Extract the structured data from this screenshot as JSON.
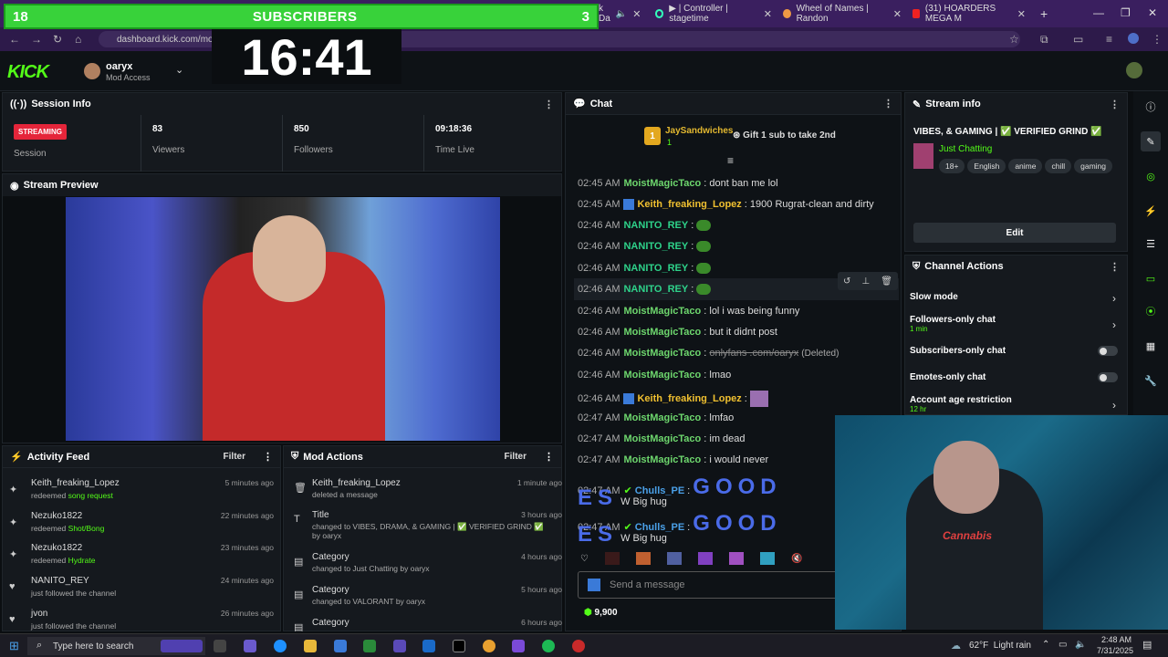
{
  "browser": {
    "tabs": [
      {
        "label": "k Da"
      },
      {
        "label": "▶ | Controller | stagetime"
      },
      {
        "label": "Wheel of Names | Randon"
      },
      {
        "label": "(31) HOARDERS MEGA M"
      }
    ],
    "new_tab": "+",
    "url": "dashboard.kick.com/mod"
  },
  "overlay": {
    "sub_left": "18",
    "sub_title": "SUBSCRIBERS",
    "sub_right": "3",
    "timer": "16:41"
  },
  "header": {
    "logo": "KICK",
    "username": "oaryx",
    "role": "Mod Access"
  },
  "session": {
    "title": "Session Info",
    "badge": "STREAMING",
    "session_label": "Session",
    "viewers_value": "83",
    "viewers_label": "Viewers",
    "followers_value": "850",
    "followers_label": "Followers",
    "time_value": "09:18:36",
    "time_label": "Time Live"
  },
  "preview": {
    "title": "Stream Preview"
  },
  "activity": {
    "title": "Activity Feed",
    "filter": "Filter",
    "items": [
      {
        "name": "Keith_freaking_Lopez",
        "action": "redeemed",
        "detail": "song request",
        "time": "5 minutes ago"
      },
      {
        "name": "Nezuko1822",
        "action": "redeemed",
        "detail": "Shot/Bong",
        "time": "22 minutes ago"
      },
      {
        "name": "Nezuko1822",
        "action": "redeemed",
        "detail": "Hydrate",
        "time": "23 minutes ago"
      },
      {
        "name": "NANITO_REY",
        "action": "just followed the channel",
        "detail": "",
        "time": "24 minutes ago"
      },
      {
        "name": "jvon",
        "action": "just followed the channel",
        "detail": "",
        "time": "26 minutes ago"
      }
    ]
  },
  "modactions": {
    "title": "Mod Actions",
    "filter": "Filter",
    "items": [
      {
        "name": "Keith_freaking_Lopez",
        "desc": "deleted a message",
        "time": "1 minute ago"
      },
      {
        "name": "Title",
        "desc": "changed to VIBES, DRAMA, & GAMING | ✅ VERIFIED GRIND ✅ by oaryx",
        "time": "3 hours ago"
      },
      {
        "name": "Category",
        "desc": "changed to Just Chatting by oaryx",
        "time": "4 hours ago"
      },
      {
        "name": "Category",
        "desc": "changed to VALORANT by oaryx",
        "time": "5 hours ago"
      },
      {
        "name": "Category",
        "desc": "",
        "time": "6 hours ago"
      }
    ]
  },
  "chat": {
    "title": "Chat",
    "gifter": "JaySandwiches",
    "gifter_count": "1",
    "gift_text": "Gift 1 sub to take 2nd",
    "messages": [
      {
        "ts": "02:45 AM",
        "user": "MoistMagicTaco",
        "color": "#6dd66d",
        "text": "dont ban me lol"
      },
      {
        "ts": "02:45 AM",
        "user": "Keith_freaking_Lopez",
        "color": "#f0c030",
        "text": "1900 Rugrat-clean and dirty"
      },
      {
        "ts": "02:46 AM",
        "user": "NANITO_REY",
        "color": "#2ed28a",
        "text": ""
      },
      {
        "ts": "02:46 AM",
        "user": "NANITO_REY",
        "color": "#2ed28a",
        "text": ""
      },
      {
        "ts": "02:46 AM",
        "user": "NANITO_REY",
        "color": "#2ed28a",
        "text": ""
      },
      {
        "ts": "02:46 AM",
        "user": "NANITO_REY",
        "color": "#2ed28a",
        "text": ""
      },
      {
        "ts": "02:46 AM",
        "user": "MoistMagicTaco",
        "color": "#6dd66d",
        "text": "lol i was being funny"
      },
      {
        "ts": "02:46 AM",
        "user": "MoistMagicTaco",
        "color": "#6dd66d",
        "text": "but it didnt post"
      },
      {
        "ts": "02:46 AM",
        "user": "MoistMagicTaco",
        "color": "#6dd66d",
        "text": "onlyfans .com/oaryx",
        "deleted": "(Deleted)"
      },
      {
        "ts": "02:46 AM",
        "user": "MoistMagicTaco",
        "color": "#6dd66d",
        "text": "lmao"
      },
      {
        "ts": "02:46 AM",
        "user": "Keith_freaking_Lopez",
        "color": "#f0c030",
        "text": ""
      },
      {
        "ts": "02:47 AM",
        "user": "MoistMagicTaco",
        "color": "#6dd66d",
        "text": "lmfao"
      },
      {
        "ts": "02:47 AM",
        "user": "MoistMagicTaco",
        "color": "#6dd66d",
        "text": "im dead"
      },
      {
        "ts": "02:47 AM",
        "user": "MoistMagicTaco",
        "color": "#6dd66d",
        "text": "i would never"
      }
    ],
    "emote_msgs": [
      {
        "ts": "02:47 AM",
        "user": "Chulls_PE",
        "big": "GOOD",
        "big2": "ES",
        "tail": "W Big hug"
      },
      {
        "ts": "02:47 AM",
        "user": "Chulls_PE",
        "big": "GOOD",
        "big2": "ES",
        "tail": "W Big hug"
      }
    ],
    "input_placeholder": "Send a message",
    "points": "9,900"
  },
  "streaminfo": {
    "title": "Stream info",
    "stream_title": "VIBES, & GAMING | ✅ VERIFIED GRIND ✅",
    "category": "Just Chatting",
    "tags": [
      "18+",
      "English",
      "anime",
      "chill",
      "gaming"
    ],
    "edit": "Edit"
  },
  "channelactions": {
    "title": "Channel Actions",
    "items": [
      {
        "label": "Slow mode",
        "sub": "",
        "kind": "chevron"
      },
      {
        "label": "Followers-only chat",
        "sub": "1 min",
        "kind": "chevron"
      },
      {
        "label": "Subscribers-only chat",
        "sub": "",
        "kind": "toggle"
      },
      {
        "label": "Emotes-only chat",
        "sub": "",
        "kind": "toggle"
      },
      {
        "label": "Account age restriction",
        "sub": "12 hr",
        "kind": "chevron"
      }
    ]
  },
  "webcam": {
    "shirt_text": "Cannabis"
  },
  "taskbar": {
    "search_placeholder": "Type here to search",
    "weather": "62°F  Light rain",
    "time": "2:48 AM",
    "date": "7/31/2025"
  },
  "colors": {
    "kick_green": "#53fc18",
    "sub_green": "#38d23a",
    "streaming_red": "#e5253a",
    "tab_purple": "#3a1f5f"
  }
}
